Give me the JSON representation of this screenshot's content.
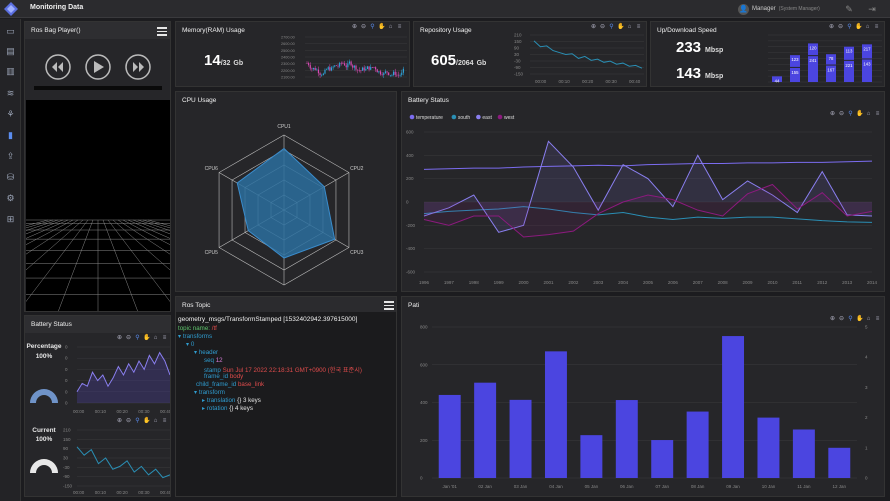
{
  "app": {
    "title": "Monitoring Data",
    "user_name": "Manager",
    "user_role": "(System Manager)"
  },
  "sidebar": {
    "icons": [
      "monitor-icon",
      "chart-doc-icon",
      "book-icon",
      "layers-icon",
      "network-icon",
      "bar-chart-icon",
      "upload-icon",
      "drive-icon",
      "settings-icon",
      "grid-icon"
    ],
    "active": 5
  },
  "player": {
    "title": "Ros Bag Player()"
  },
  "battery_status_left": {
    "title": "Battery Status",
    "percentage_label": "Percentage",
    "percentage_value": "100%",
    "current_label": "Current",
    "current_value": "100%",
    "chart1": {
      "y_ticks": [
        "0",
        "0",
        "0",
        "0",
        "0",
        "0"
      ],
      "x_ticks": [
        "00:00",
        "00:10",
        "00:20",
        "00:30",
        "00:40"
      ]
    },
    "chart2": {
      "y_ticks": [
        "210",
        "150",
        "90",
        "30",
        "-30",
        "-90",
        "-150"
      ],
      "x_ticks": [
        "00:00",
        "00:10",
        "00:20",
        "00:30",
        "00:40"
      ]
    }
  },
  "memory": {
    "title": "Memory(RAM) Usage",
    "value": "14",
    "total": "/32",
    "unit": "Gb",
    "y_ticks": [
      "2700.00",
      "2600.00",
      "2500.00",
      "2400.00",
      "2300.00",
      "2200.00",
      "2100.00"
    ]
  },
  "repository": {
    "title": "Repository Usage",
    "value": "605",
    "total": "/2064",
    "unit": "Gb",
    "y_ticks": [
      "210",
      "150",
      "90",
      "30",
      "-30",
      "-90",
      "-150"
    ],
    "x_ticks": [
      "00:00",
      "00:10",
      "00:20",
      "00:30",
      "00:40"
    ]
  },
  "speed": {
    "title": "Up/Download Speed",
    "up_value": "233",
    "down_value": "143",
    "unit": "Mbsp",
    "bars": [
      {
        "top": "",
        "bottom": "44"
      },
      {
        "top": "123",
        "bottom": "155"
      },
      {
        "top": "120",
        "bottom": "241"
      },
      {
        "top": "78",
        "bottom": "167"
      },
      {
        "top": "113",
        "bottom": "221"
      },
      {
        "top": "217",
        "bottom": "143"
      }
    ]
  },
  "cpu": {
    "title": "CPU Usage",
    "labels": [
      "CPU1",
      "CPU2",
      "CPU3",
      "CPU4",
      "CPU5",
      "CPU6"
    ],
    "values": [
      0.82,
      0.62,
      0.78,
      0.64,
      0.55,
      0.72
    ]
  },
  "ros_topic": {
    "title": "Ros Topic",
    "header_line": "geometry_msgs/TransformStamped [1532402942.397615000]",
    "topic_label": "topic name:",
    "topic_value": "/tf",
    "transforms": "transforms",
    "idx": "0",
    "header": "header",
    "seq_label": "seq",
    "seq_value": "12",
    "stamp_label": "stamp",
    "stamp_value": "Sun Jul 17 2022 22:18:31 GMT+0900 (한국 표준시)",
    "frame_id_label": "frame_id",
    "frame_id_value": "body",
    "child_label": "child_frame_id",
    "child_value": "base_link",
    "transform": "transform",
    "translation": "translation",
    "translation_keys": "{} 3 keys",
    "rotation": "rotation",
    "rotation_keys": "{} 4 keys"
  },
  "battery_main": {
    "title": "Battery Status",
    "legend": [
      "temperature",
      "south",
      "east",
      "west"
    ],
    "y_ticks": [
      "600",
      "400",
      "200",
      "0",
      "-200",
      "-400",
      "-600"
    ],
    "x_ticks": [
      "1996",
      "1997",
      "1998",
      "1999",
      "2000",
      "2001",
      "2002",
      "2003",
      "2004",
      "2005",
      "2006",
      "2007",
      "2008",
      "2009",
      "2010",
      "2011",
      "2012",
      "2013",
      "2014"
    ]
  },
  "pati": {
    "title": "Pati",
    "y_left": [
      "800",
      "600",
      "400",
      "200",
      "0"
    ],
    "y_right": [
      "5",
      "4",
      "3",
      "2",
      "1",
      "0"
    ],
    "x_ticks": [
      "Jan '01",
      "02 Jan",
      "03 Jan",
      "04 Jan",
      "05 Jan",
      "06 Jan",
      "07 Jan",
      "08 Jan",
      "09 Jan",
      "10 Jan",
      "11 Jan",
      "12 Jan"
    ]
  },
  "chart_data": [
    {
      "type": "bar",
      "title": "Pati",
      "categories": [
        "Jan '01",
        "02 Jan",
        "03 Jan",
        "04 Jan",
        "05 Jan",
        "06 Jan",
        "07 Jan",
        "08 Jan",
        "09 Jan",
        "10 Jan",
        "11 Jan",
        "12 Jan"
      ],
      "values": [
        440,
        505,
        414,
        671,
        227,
        413,
        201,
        352,
        752,
        320,
        257,
        160
      ],
      "ylim": [
        0,
        800
      ],
      "color": "#4b45e0"
    },
    {
      "type": "line",
      "title": "Battery Status",
      "x": [
        1996,
        1997,
        1998,
        1999,
        2000,
        2001,
        2002,
        2003,
        2004,
        2005,
        2006,
        2007,
        2008,
        2009,
        2010,
        2011,
        2012,
        2013,
        2014
      ],
      "series": [
        {
          "name": "temperature",
          "color": "#7b6cf0",
          "values": [
            280,
            285,
            290,
            290,
            300,
            305,
            310,
            315,
            310,
            320,
            325,
            330,
            330,
            335,
            335,
            340,
            340,
            345,
            350
          ]
        },
        {
          "name": "south",
          "color": "#2a8fb5",
          "values": [
            -100,
            -80,
            -70,
            -60,
            -40,
            -60,
            -90,
            -110,
            -90,
            -130,
            -150,
            -130,
            -140,
            -130,
            -130,
            -145,
            -160,
            -170,
            -175
          ]
        },
        {
          "name": "east",
          "color": "#8a7ff0",
          "values": [
            -120,
            -50,
            60,
            -260,
            -200,
            520,
            300,
            -70,
            320,
            200,
            -40,
            400,
            20,
            180,
            60,
            -90,
            260,
            -110,
            -120
          ]
        },
        {
          "name": "west",
          "color": "#8c1a7e",
          "values": [
            -150,
            -200,
            -120,
            -120,
            -300,
            -280,
            -250,
            -100,
            0,
            60,
            20,
            -70,
            -120,
            70,
            150,
            -60,
            80,
            -120,
            -80
          ]
        }
      ],
      "ylim": [
        -600,
        600
      ]
    },
    {
      "type": "radar",
      "title": "CPU Usage",
      "categories": [
        "CPU1",
        "CPU2",
        "CPU3",
        "CPU4",
        "CPU5",
        "CPU6"
      ],
      "values": [
        0.82,
        0.62,
        0.78,
        0.64,
        0.55,
        0.72
      ]
    }
  ]
}
